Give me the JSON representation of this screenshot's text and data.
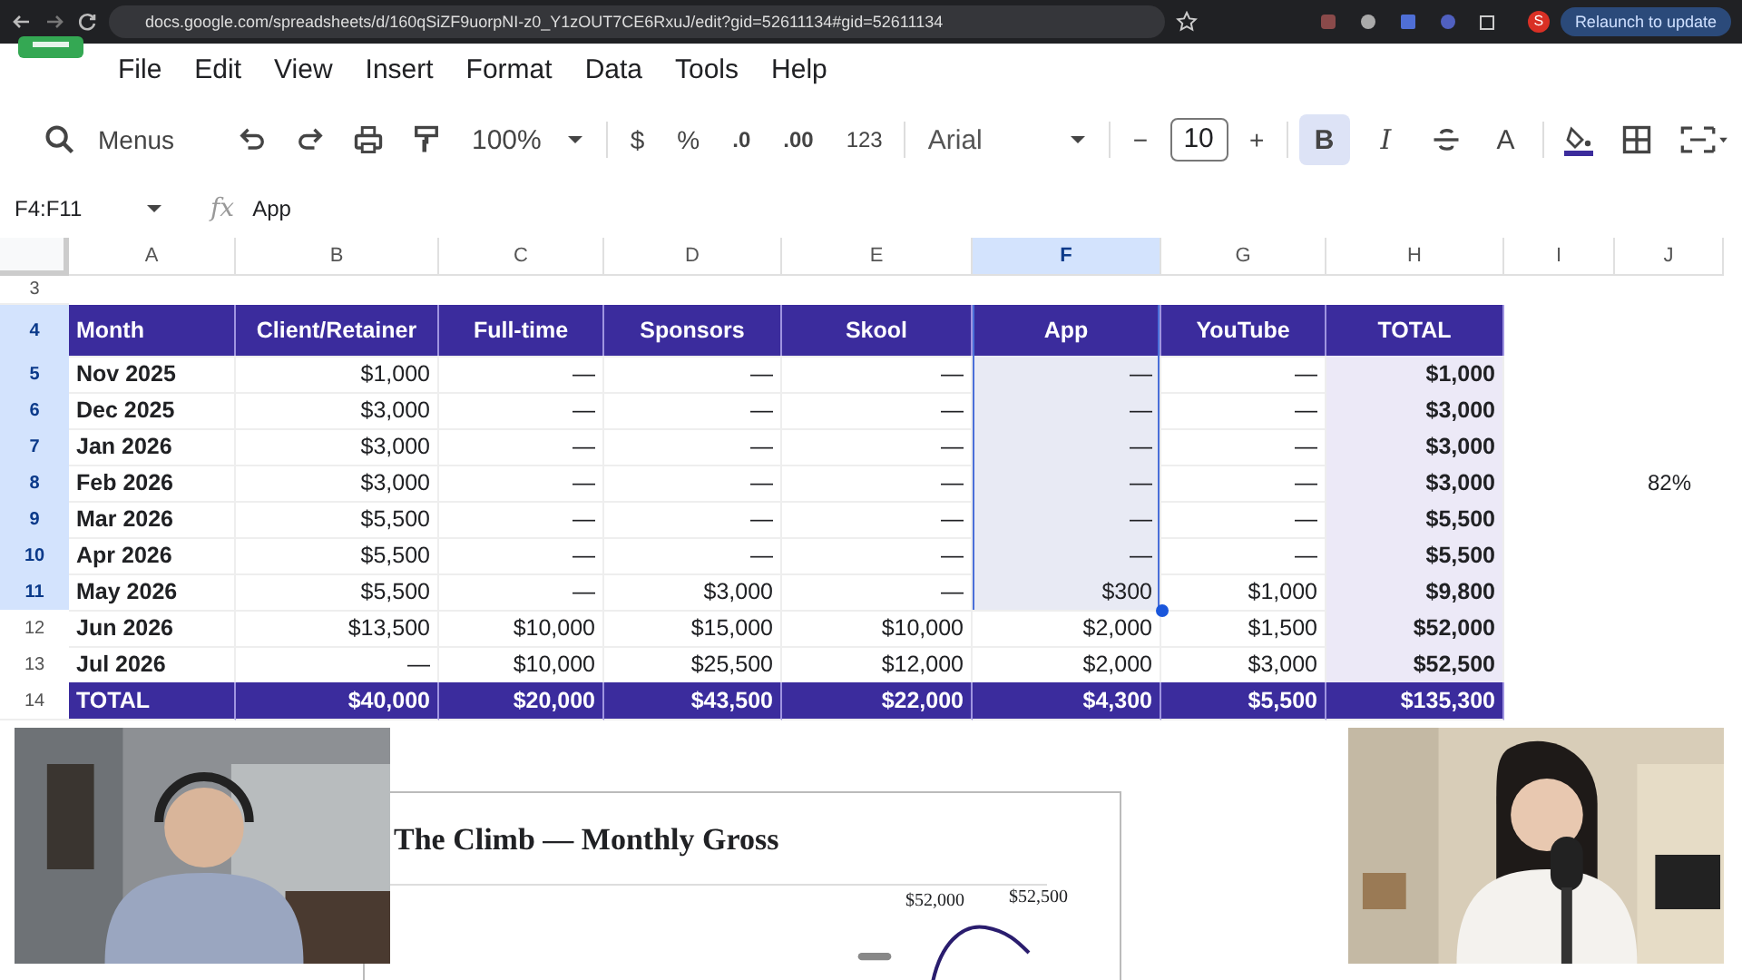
{
  "browser": {
    "url": "docs.google.com/spreadsheets/d/160qSiZF9uorpNI-z0_Y1zOUT7CE6RxuJ/edit?gid=52611134#gid=52611134",
    "profile": "S",
    "update_button": "Relaunch to update"
  },
  "menu": [
    "File",
    "Edit",
    "View",
    "Insert",
    "Format",
    "Data",
    "Tools",
    "Help"
  ],
  "toolbar": {
    "search": "Menus",
    "zoom": "100%",
    "currency": "$",
    "percent": "%",
    "decrease_decimals": ".0",
    "increase_decimals": ".00",
    "number_format": "123",
    "font": "Arial",
    "size_minus": "−",
    "font_size": "10",
    "size_plus": "+",
    "bold": "B",
    "bold_on": true,
    "italic": "I",
    "text_color": "A"
  },
  "formula_bar": {
    "name_box": "F4:F11",
    "fx": "fx",
    "value": "App"
  },
  "columns": [
    {
      "label": "A",
      "selected": false
    },
    {
      "label": "B",
      "selected": false
    },
    {
      "label": "C",
      "selected": false
    },
    {
      "label": "D",
      "selected": false
    },
    {
      "label": "E",
      "selected": false
    },
    {
      "label": "F",
      "selected": true
    },
    {
      "label": "G",
      "selected": false
    },
    {
      "label": "H",
      "selected": false
    },
    {
      "label": "I",
      "selected": false
    },
    {
      "label": "J",
      "selected": false
    }
  ],
  "rows": [
    {
      "number": "3",
      "selected": false,
      "kind": "blank"
    },
    {
      "number": "4",
      "selected": true,
      "kind": "header",
      "cells": [
        "Month",
        "Client/Retainer",
        "Full-time",
        "Sponsors",
        "Skool",
        "App",
        "YouTube",
        "TOTAL"
      ]
    },
    {
      "number": "5",
      "selected": true,
      "kind": "data",
      "cells": [
        "Nov 2025",
        "$1,000",
        "—",
        "—",
        "—",
        "—",
        "—",
        "$1,000"
      ]
    },
    {
      "number": "6",
      "selected": true,
      "kind": "data",
      "cells": [
        "Dec 2025",
        "$3,000",
        "—",
        "—",
        "—",
        "—",
        "—",
        "$3,000"
      ]
    },
    {
      "number": "7",
      "selected": true,
      "kind": "data",
      "cells": [
        "Jan 2026",
        "$3,000",
        "—",
        "—",
        "—",
        "—",
        "—",
        "$3,000"
      ]
    },
    {
      "number": "8",
      "selected": true,
      "kind": "data",
      "cells": [
        "Feb 2026",
        "$3,000",
        "—",
        "—",
        "—",
        "—",
        "—",
        "$3,000"
      ],
      "note": "82%"
    },
    {
      "number": "9",
      "selected": true,
      "kind": "data",
      "cells": [
        "Mar 2026",
        "$5,500",
        "—",
        "—",
        "—",
        "—",
        "—",
        "$5,500"
      ]
    },
    {
      "number": "10",
      "selected": true,
      "kind": "data",
      "cells": [
        "Apr 2026",
        "$5,500",
        "—",
        "—",
        "—",
        "—",
        "—",
        "$5,500"
      ]
    },
    {
      "number": "11",
      "selected": true,
      "kind": "data",
      "cells": [
        "May 2026",
        "$5,500",
        "—",
        "$3,000",
        "—",
        "$300",
        "$1,000",
        "$9,800"
      ]
    },
    {
      "number": "12",
      "selected": false,
      "kind": "data",
      "cells": [
        "Jun 2026",
        "$13,500",
        "$10,000",
        "$15,000",
        "$10,000",
        "$2,000",
        "$1,500",
        "$52,000"
      ]
    },
    {
      "number": "13",
      "selected": false,
      "kind": "data",
      "cells": [
        "Jul 2026",
        "—",
        "$10,000",
        "$25,500",
        "$12,000",
        "$2,000",
        "$3,000",
        "$52,500"
      ]
    },
    {
      "number": "14",
      "selected": false,
      "kind": "total",
      "cells": [
        "TOTAL",
        "$40,000",
        "$20,000",
        "$43,500",
        "$22,000",
        "$4,300",
        "$5,500",
        "$135,300"
      ]
    }
  ],
  "chart": {
    "title": "The Climb — Monthly Gross",
    "labels": [
      "$52,000",
      "$52,500"
    ]
  }
}
